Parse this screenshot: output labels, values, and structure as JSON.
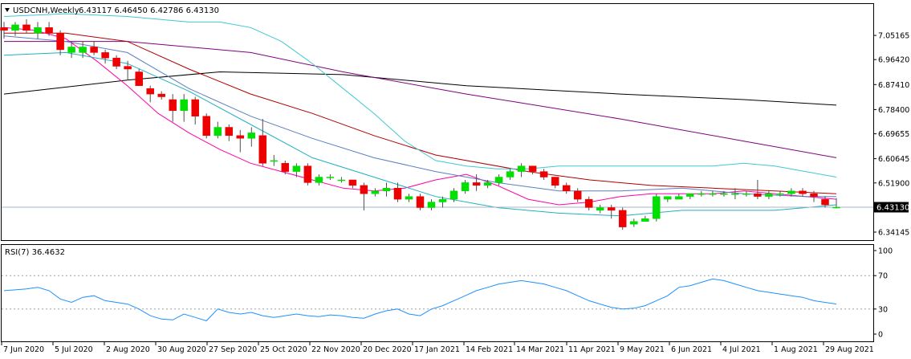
{
  "chart_data": {
    "type": "candlestick",
    "symbol_header": "USDCNH,Weekly",
    "ohlc_header": "6.43117 6.46450 6.42786 6.43130",
    "current_price_label": "6.43130",
    "current_price": 6.4313,
    "price_axis": {
      "ticks": [
        "7.05165",
        "6.96420",
        "6.87410",
        "6.78400",
        "6.69655",
        "6.60645",
        "6.51900",
        "6.43130",
        "6.34145"
      ],
      "ylim": [
        6.3125,
        7.165
      ]
    },
    "x_labels": [
      "7 Jun 2020",
      "5 Jul 2020",
      "2 Aug 2020",
      "30 Aug 2020",
      "27 Sep 2020",
      "25 Oct 2020",
      "22 Nov 2020",
      "20 Dec 2020",
      "17 Jan 2021",
      "14 Feb 2021",
      "14 Mar 2021",
      "11 Apr 2021",
      "9 May 2021",
      "6 Jun 2021",
      "4 Jul 2021",
      "1 Aug 2021",
      "29 Aug 2021"
    ],
    "candles": [
      {
        "o": 7.08,
        "h": 7.1,
        "l": 7.04,
        "c": 7.07
      },
      {
        "o": 7.07,
        "h": 7.1,
        "l": 7.05,
        "c": 7.09
      },
      {
        "o": 7.09,
        "h": 7.11,
        "l": 7.06,
        "c": 7.07
      },
      {
        "o": 7.06,
        "h": 7.1,
        "l": 7.04,
        "c": 7.08
      },
      {
        "o": 7.08,
        "h": 7.1,
        "l": 7.05,
        "c": 7.06
      },
      {
        "o": 7.06,
        "h": 7.07,
        "l": 6.98,
        "c": 7.0
      },
      {
        "o": 6.99,
        "h": 7.03,
        "l": 6.97,
        "c": 7.01
      },
      {
        "o": 6.99,
        "h": 7.03,
        "l": 6.97,
        "c": 7.01
      },
      {
        "o": 7.01,
        "h": 7.03,
        "l": 6.98,
        "c": 6.99
      },
      {
        "o": 6.99,
        "h": 7.0,
        "l": 6.95,
        "c": 6.97
      },
      {
        "o": 6.97,
        "h": 6.98,
        "l": 6.93,
        "c": 6.94
      },
      {
        "o": 6.94,
        "h": 6.96,
        "l": 6.89,
        "c": 6.93
      },
      {
        "o": 6.92,
        "h": 6.93,
        "l": 6.87,
        "c": 6.87
      },
      {
        "o": 6.86,
        "h": 6.87,
        "l": 6.81,
        "c": 6.84
      },
      {
        "o": 6.84,
        "h": 6.85,
        "l": 6.82,
        "c": 6.83
      },
      {
        "o": 6.82,
        "h": 6.84,
        "l": 6.74,
        "c": 6.78
      },
      {
        "o": 6.78,
        "h": 6.84,
        "l": 6.74,
        "c": 6.82
      },
      {
        "o": 6.82,
        "h": 6.83,
        "l": 6.73,
        "c": 6.76
      },
      {
        "o": 6.76,
        "h": 6.77,
        "l": 6.68,
        "c": 6.69
      },
      {
        "o": 6.69,
        "h": 6.74,
        "l": 6.68,
        "c": 6.72
      },
      {
        "o": 6.72,
        "h": 6.73,
        "l": 6.67,
        "c": 6.69
      },
      {
        "o": 6.69,
        "h": 6.71,
        "l": 6.63,
        "c": 6.68
      },
      {
        "o": 6.68,
        "h": 6.72,
        "l": 6.65,
        "c": 6.7
      },
      {
        "o": 6.69,
        "h": 6.75,
        "l": 6.58,
        "c": 6.59
      },
      {
        "o": 6.6,
        "h": 6.62,
        "l": 6.58,
        "c": 6.6
      },
      {
        "o": 6.59,
        "h": 6.6,
        "l": 6.55,
        "c": 6.56
      },
      {
        "o": 6.56,
        "h": 6.59,
        "l": 6.54,
        "c": 6.58
      },
      {
        "o": 6.58,
        "h": 6.59,
        "l": 6.51,
        "c": 6.52
      },
      {
        "o": 6.52,
        "h": 6.55,
        "l": 6.51,
        "c": 6.54
      },
      {
        "o": 6.54,
        "h": 6.55,
        "l": 6.53,
        "c": 6.54
      },
      {
        "o": 6.53,
        "h": 6.54,
        "l": 6.52,
        "c": 6.53
      },
      {
        "o": 6.53,
        "h": 6.53,
        "l": 6.5,
        "c": 6.51
      },
      {
        "o": 6.51,
        "h": 6.52,
        "l": 6.42,
        "c": 6.48
      },
      {
        "o": 6.48,
        "h": 6.5,
        "l": 6.47,
        "c": 6.49
      },
      {
        "o": 6.49,
        "h": 6.52,
        "l": 6.47,
        "c": 6.5
      },
      {
        "o": 6.5,
        "h": 6.52,
        "l": 6.45,
        "c": 6.46
      },
      {
        "o": 6.46,
        "h": 6.48,
        "l": 6.45,
        "c": 6.47
      },
      {
        "o": 6.47,
        "h": 6.48,
        "l": 6.42,
        "c": 6.43
      },
      {
        "o": 6.43,
        "h": 6.46,
        "l": 6.42,
        "c": 6.45
      },
      {
        "o": 6.45,
        "h": 6.47,
        "l": 6.43,
        "c": 6.46
      },
      {
        "o": 6.46,
        "h": 6.5,
        "l": 6.45,
        "c": 6.49
      },
      {
        "o": 6.49,
        "h": 6.53,
        "l": 6.48,
        "c": 6.52
      },
      {
        "o": 6.52,
        "h": 6.55,
        "l": 6.49,
        "c": 6.51
      },
      {
        "o": 6.51,
        "h": 6.53,
        "l": 6.5,
        "c": 6.52
      },
      {
        "o": 6.52,
        "h": 6.55,
        "l": 6.51,
        "c": 6.54
      },
      {
        "o": 6.54,
        "h": 6.57,
        "l": 6.53,
        "c": 6.56
      },
      {
        "o": 6.56,
        "h": 6.59,
        "l": 6.54,
        "c": 6.58
      },
      {
        "o": 6.58,
        "h": 6.58,
        "l": 6.55,
        "c": 6.56
      },
      {
        "o": 6.56,
        "h": 6.57,
        "l": 6.53,
        "c": 6.54
      },
      {
        "o": 6.54,
        "h": 6.54,
        "l": 6.5,
        "c": 6.51
      },
      {
        "o": 6.51,
        "h": 6.52,
        "l": 6.48,
        "c": 6.49
      },
      {
        "o": 6.49,
        "h": 6.5,
        "l": 6.45,
        "c": 6.46
      },
      {
        "o": 6.46,
        "h": 6.47,
        "l": 6.42,
        "c": 6.43
      },
      {
        "o": 6.42,
        "h": 6.44,
        "l": 6.41,
        "c": 6.43
      },
      {
        "o": 6.43,
        "h": 6.44,
        "l": 6.39,
        "c": 6.42
      },
      {
        "o": 6.42,
        "h": 6.43,
        "l": 6.35,
        "c": 6.36
      },
      {
        "o": 6.37,
        "h": 6.39,
        "l": 6.36,
        "c": 6.38
      },
      {
        "o": 6.38,
        "h": 6.4,
        "l": 6.38,
        "c": 6.39
      },
      {
        "o": 6.39,
        "h": 6.48,
        "l": 6.38,
        "c": 6.47
      },
      {
        "o": 6.46,
        "h": 6.47,
        "l": 6.45,
        "c": 6.47
      },
      {
        "o": 6.46,
        "h": 6.48,
        "l": 6.46,
        "c": 6.47
      },
      {
        "o": 6.47,
        "h": 6.48,
        "l": 6.46,
        "c": 6.48
      },
      {
        "o": 6.48,
        "h": 6.49,
        "l": 6.47,
        "c": 6.48
      },
      {
        "o": 6.48,
        "h": 6.49,
        "l": 6.47,
        "c": 6.48
      },
      {
        "o": 6.48,
        "h": 6.49,
        "l": 6.47,
        "c": 6.48
      },
      {
        "o": 6.48,
        "h": 6.5,
        "l": 6.46,
        "c": 6.48
      },
      {
        "o": 6.48,
        "h": 6.49,
        "l": 6.47,
        "c": 6.48
      },
      {
        "o": 6.48,
        "h": 6.53,
        "l": 6.46,
        "c": 6.47
      },
      {
        "o": 6.47,
        "h": 6.49,
        "l": 6.46,
        "c": 6.48
      },
      {
        "o": 6.48,
        "h": 6.49,
        "l": 6.47,
        "c": 6.48
      },
      {
        "o": 6.48,
        "h": 6.5,
        "l": 6.47,
        "c": 6.49
      },
      {
        "o": 6.49,
        "h": 6.5,
        "l": 6.47,
        "c": 6.48
      },
      {
        "o": 6.48,
        "h": 6.49,
        "l": 6.45,
        "c": 6.47
      },
      {
        "o": 6.46,
        "h": 6.47,
        "l": 6.43,
        "c": 6.44
      },
      {
        "o": 6.43117,
        "h": 6.4645,
        "l": 6.42786,
        "c": 6.4313
      }
    ],
    "indicator_lines": [
      {
        "name": "",
        "color": "#000000",
        "points": [
          [
            0,
            6.84
          ],
          [
            20,
            6.89
          ],
          [
            35,
            6.92
          ],
          [
            55,
            6.91
          ],
          [
            75,
            6.87
          ],
          [
            100,
            6.84
          ],
          [
            120,
            6.82
          ],
          [
            135,
            6.8
          ]
        ]
      },
      {
        "name": "",
        "color": "#800080",
        "points": [
          [
            0,
            7.03
          ],
          [
            20,
            7.03
          ],
          [
            40,
            6.99
          ],
          [
            55,
            6.92
          ],
          [
            75,
            6.84
          ],
          [
            100,
            6.75
          ],
          [
            120,
            6.67
          ],
          [
            135,
            6.61
          ]
        ]
      },
      {
        "name": "",
        "color": "#b00000",
        "points": [
          [
            0,
            7.06
          ],
          [
            10,
            7.06
          ],
          [
            20,
            7.03
          ],
          [
            30,
            6.93
          ],
          [
            40,
            6.84
          ],
          [
            50,
            6.77
          ],
          [
            60,
            6.69
          ],
          [
            70,
            6.62
          ],
          [
            85,
            6.56
          ],
          [
            95,
            6.53
          ],
          [
            105,
            6.51
          ],
          [
            115,
            6.5
          ],
          [
            125,
            6.49
          ],
          [
            135,
            6.48
          ]
        ]
      },
      {
        "name": "",
        "color": "#ff00aa",
        "points": [
          [
            0,
            7.08
          ],
          [
            5,
            7.07
          ],
          [
            10,
            7.04
          ],
          [
            15,
            6.96
          ],
          [
            20,
            6.87
          ],
          [
            25,
            6.77
          ],
          [
            30,
            6.7
          ],
          [
            35,
            6.64
          ],
          [
            40,
            6.59
          ],
          [
            45,
            6.56
          ],
          [
            50,
            6.53
          ],
          [
            55,
            6.5
          ],
          [
            60,
            6.49
          ],
          [
            65,
            6.5
          ],
          [
            70,
            6.53
          ],
          [
            75,
            6.55
          ],
          [
            80,
            6.51
          ],
          [
            85,
            6.46
          ],
          [
            90,
            6.44
          ],
          [
            95,
            6.45
          ],
          [
            100,
            6.47
          ],
          [
            105,
            6.48
          ],
          [
            110,
            6.48
          ],
          [
            115,
            6.48
          ],
          [
            120,
            6.49
          ],
          [
            125,
            6.48
          ],
          [
            130,
            6.47
          ],
          [
            135,
            6.46
          ]
        ]
      },
      {
        "name": "",
        "color": "#5a7fc0",
        "points": [
          [
            0,
            7.05
          ],
          [
            10,
            7.03
          ],
          [
            20,
            6.99
          ],
          [
            30,
            6.86
          ],
          [
            40,
            6.76
          ],
          [
            50,
            6.68
          ],
          [
            60,
            6.61
          ],
          [
            70,
            6.56
          ],
          [
            80,
            6.52
          ],
          [
            90,
            6.49
          ],
          [
            100,
            6.49
          ],
          [
            110,
            6.5
          ],
          [
            120,
            6.48
          ],
          [
            130,
            6.47
          ],
          [
            135,
            6.47
          ]
        ]
      },
      {
        "name": "",
        "color": "#20b0c0",
        "points": [
          [
            0,
            6.98
          ],
          [
            10,
            6.99
          ],
          [
            20,
            6.95
          ],
          [
            30,
            6.85
          ],
          [
            40,
            6.73
          ],
          [
            50,
            6.61
          ],
          [
            60,
            6.54
          ],
          [
            70,
            6.47
          ],
          [
            80,
            6.43
          ],
          [
            90,
            6.41
          ],
          [
            100,
            6.4
          ],
          [
            105,
            6.41
          ],
          [
            110,
            6.42
          ],
          [
            115,
            6.42
          ],
          [
            120,
            6.42
          ],
          [
            125,
            6.42
          ],
          [
            130,
            6.43
          ],
          [
            135,
            6.44
          ]
        ]
      },
      {
        "name": "",
        "color": "#40c8d0",
        "points": [
          [
            0,
            7.12
          ],
          [
            10,
            7.13
          ],
          [
            20,
            7.12
          ],
          [
            30,
            7.1
          ],
          [
            35,
            7.1
          ],
          [
            40,
            7.08
          ],
          [
            45,
            7.03
          ],
          [
            50,
            6.95
          ],
          [
            55,
            6.86
          ],
          [
            60,
            6.77
          ],
          [
            65,
            6.67
          ],
          [
            70,
            6.6
          ],
          [
            75,
            6.58
          ],
          [
            80,
            6.57
          ],
          [
            85,
            6.57
          ],
          [
            90,
            6.58
          ],
          [
            95,
            6.58
          ],
          [
            100,
            6.58
          ],
          [
            105,
            6.58
          ],
          [
            110,
            6.58
          ],
          [
            115,
            6.58
          ],
          [
            120,
            6.59
          ],
          [
            125,
            6.58
          ],
          [
            130,
            6.56
          ],
          [
            135,
            6.54
          ]
        ]
      }
    ],
    "rsi": {
      "title": "RSI(7) 36.4632",
      "ticks": [
        "100",
        "70",
        "30",
        "0"
      ],
      "levels": [
        70,
        30
      ],
      "ylim": [
        0,
        100
      ],
      "color": "#1e90ff",
      "values": [
        52,
        53,
        54,
        56,
        52,
        42,
        38,
        44,
        46,
        40,
        38,
        36,
        30,
        22,
        18,
        17,
        24,
        20,
        16,
        30,
        26,
        24,
        26,
        22,
        20,
        22,
        24,
        22,
        21,
        23,
        22,
        20,
        19,
        24,
        28,
        30,
        24,
        22,
        30,
        34,
        40,
        46,
        52,
        56,
        60,
        62,
        64,
        62,
        60,
        56,
        52,
        46,
        40,
        36,
        32,
        30,
        31,
        34,
        40,
        46,
        56,
        58,
        62,
        66,
        64,
        60,
        56,
        52,
        50,
        48,
        46,
        44,
        40,
        38,
        36
      ]
    }
  }
}
